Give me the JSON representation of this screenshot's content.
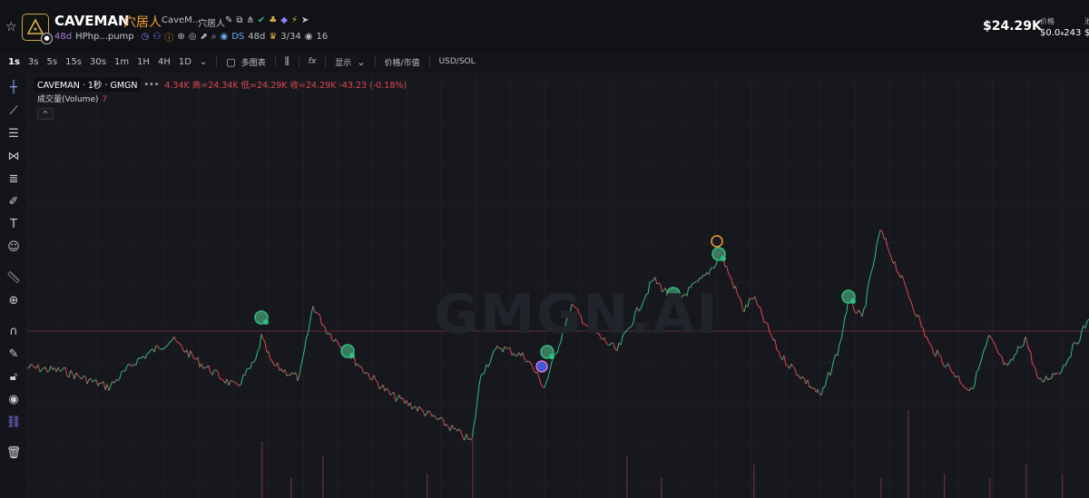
{
  "header": {
    "token_name": "CAVEMAN",
    "token_cn": "穴居人",
    "token_short": "CaveM...",
    "token_short_cn": "穴居人",
    "age": "48d",
    "pair_address": "HPhp...pump",
    "ds_label": "DS",
    "ds_age": "48d",
    "holders_ratio": "3/34",
    "watchers": "16",
    "market_cap": "$24.29K",
    "price_label": "价格",
    "price_value": "$0.0₄243",
    "edge_label": "池",
    "edge_value": "$"
  },
  "toolbar": {
    "timeframes": [
      "1s",
      "3s",
      "5s",
      "15s",
      "30s",
      "1m",
      "1H",
      "4H",
      "1D"
    ],
    "active_timeframe": "1s",
    "multi_chart": "多图表",
    "indicator_icon": "fx",
    "display": "显示",
    "price_mcap": "价格/市值",
    "currency": "USD/SOL"
  },
  "legend": {
    "title": "CAVEMAN · 1秒 · GMGN",
    "dots": "•••",
    "ohlc": "4.34K 高=24.34K 低=24.29K 收=24.29K -43.23 (-0.18%)",
    "volume_label": "成交量(Volume)",
    "volume_value": "7",
    "collapse_label": "^"
  },
  "watermark": "GMGN.AI",
  "icons": {
    "left_tools": [
      "crosshair-icon",
      "trendline-icon",
      "channel-icon",
      "pattern-icon",
      "fib-icon",
      "brush-icon",
      "text-icon",
      "emoji-icon",
      "ruler-icon",
      "zoom-in-icon",
      "magnet-icon",
      "lock-draw-icon",
      "lock-icon",
      "eye-icon",
      "link-icon",
      "trash-icon"
    ]
  },
  "colors": {
    "background": "#17181d",
    "up": "#2dbd85",
    "down": "#e0454f",
    "accent": "#f0a02f"
  }
}
